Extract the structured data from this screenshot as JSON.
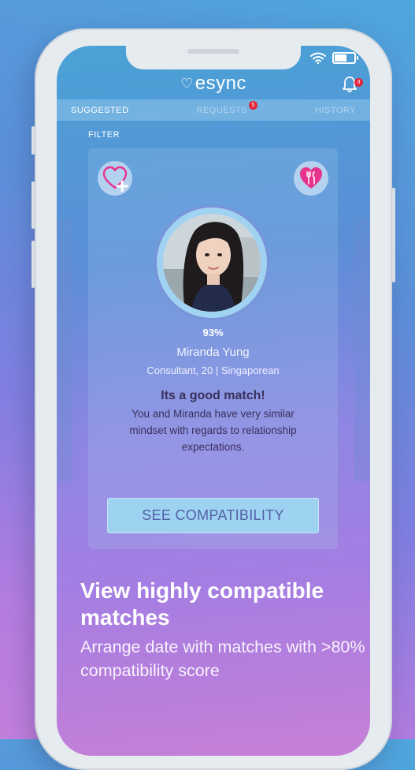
{
  "app": {
    "name": "esync",
    "notification_count": "3"
  },
  "tabs": [
    {
      "label": "SUGGESTED",
      "active": true
    },
    {
      "label": "REQUESTS",
      "badge": "5"
    },
    {
      "label": "HISTORY"
    }
  ],
  "filter_label": "FILTER",
  "card": {
    "left_icon": "heart-plus-icon",
    "right_icon": "heart-cutlery-icon",
    "score": "93%",
    "score_fraction": 0.93,
    "name": "Miranda Yung",
    "subtitle": "Consultant, 20 | Singaporean",
    "match_title": "Its a good match!",
    "match_description": "You and Miranda have very similar mindset with regards to relationship expectations.",
    "button_label": "SEE COMPATIBILITY"
  },
  "promo": {
    "headline": "View highly compatible matches",
    "subline": "Arrange date with matches with >80% compatibility score"
  },
  "colors": {
    "accent_pink": "#e7338c",
    "badge_red": "#e3263b",
    "button_bg": "#9ed2f1",
    "button_text": "#5361a8",
    "match_text": "#3a2f5a"
  }
}
